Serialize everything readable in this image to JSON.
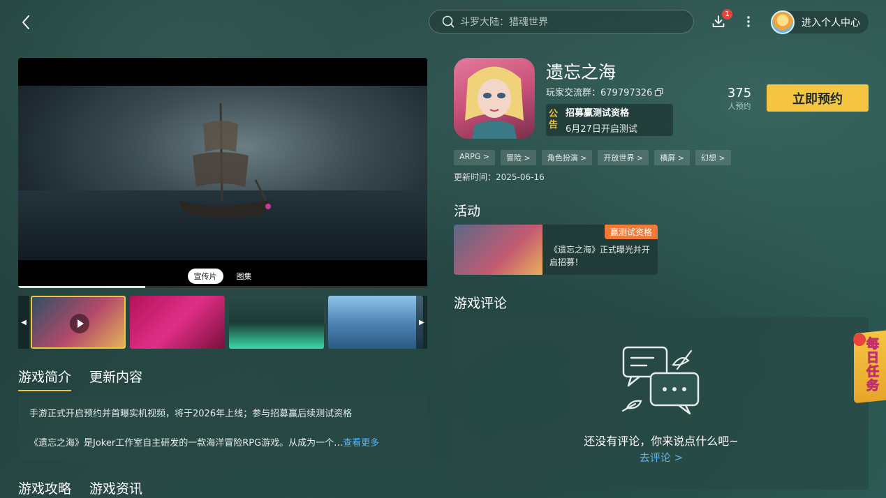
{
  "header": {
    "search_placeholder": "斗罗大陆：猎魂世界",
    "download_badge": "1",
    "user_center_label": "进入个人中心"
  },
  "video": {
    "tabs": [
      "宣传片",
      "图集"
    ],
    "active_tab": "宣传片",
    "progress": 0.31
  },
  "intro_tabs": [
    "游戏简介",
    "更新内容"
  ],
  "intro": {
    "line1": "手游正式开启预约并首曝实机视频，将于2026年上线；参与招募赢后续测试资格",
    "line2": "《遗忘之海》是Joker工作室自主研发的一款海洋冒险RPG游戏。从成为一个…",
    "more": "查看更多"
  },
  "bottom_tabs": [
    "游戏攻略",
    "游戏资讯"
  ],
  "game": {
    "title": "遗忘之海",
    "group_label": "玩家交流群：",
    "group_number": "679797326",
    "notice_tag": "公告",
    "notice_title": "招募赢测试资格",
    "notice_sub": "6月27日开启测试",
    "reserve_count": "375",
    "reserve_label": "人预约",
    "reserve_button": "立即预约",
    "tags": [
      "ARPG >",
      "冒险 >",
      "角色扮演 >",
      "开放世界 >",
      "横屏 >",
      "幻想 >"
    ],
    "update_time": "更新时间：2025-06-16"
  },
  "activity": {
    "heading": "活动",
    "badge": "赢测试资格",
    "text": "《遗忘之海》正式曝光并开启招募！"
  },
  "reviews": {
    "heading": "游戏评论",
    "empty_text": "还没有评论，你来说点什么吧~",
    "go_review": "去评论 >"
  },
  "daily_task": {
    "label": "每日任务"
  },
  "colors": {
    "accent": "#f5c542",
    "link": "#5ab4f2",
    "badge_red": "#e9443c",
    "activity_badge": "#f07a38"
  }
}
